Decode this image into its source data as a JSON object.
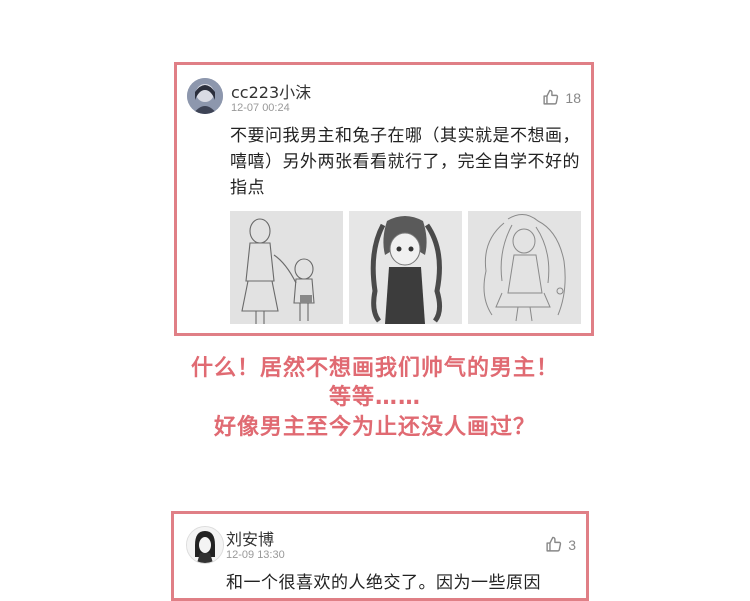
{
  "comments": [
    {
      "username": "cc223小沫",
      "timestamp": "12-07 00:24",
      "likes": "18",
      "text": "不要问我男主和兔子在哪（其实就是不想画，嘻嘻）另外两张看看就行了，完全自学不好的指点",
      "images": [
        "sketch-two-children",
        "sketch-twin-tail-girl",
        "sketch-long-hair-girl"
      ]
    },
    {
      "username": "刘安博",
      "timestamp": "12-09 13:30",
      "likes": "3",
      "text": "和一个很喜欢的人绝交了。因为一些原因"
    }
  ],
  "caption": {
    "line1": "什么！居然不想画我们帅气的男主！",
    "line2": "等等……",
    "line3": "好像男主至今为止还没人画过？"
  },
  "colors": {
    "frame": "#e07f86",
    "caption": "#e06a72"
  },
  "icons": {
    "like": "thumbs-up-icon"
  }
}
